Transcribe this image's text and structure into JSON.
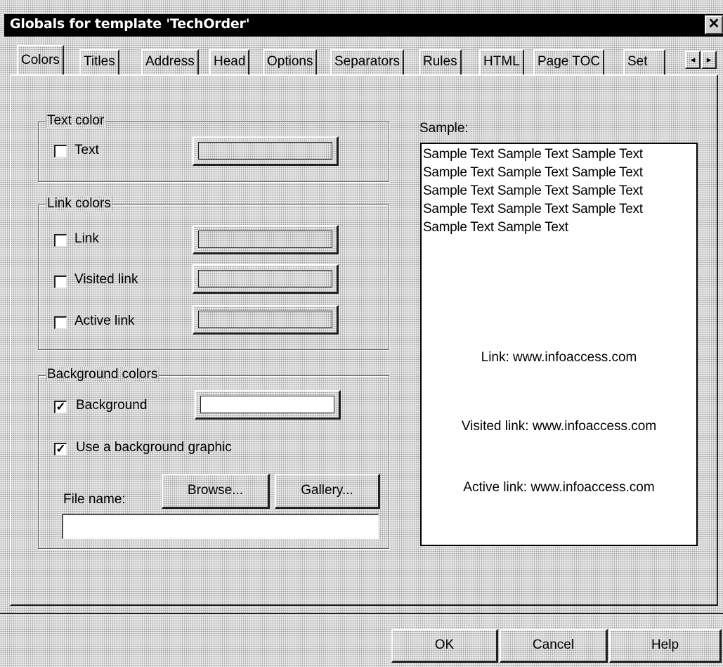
{
  "window": {
    "title": "Globals for template 'TechOrder'",
    "close_symbol": "✕"
  },
  "tabs": [
    {
      "label": "Colors",
      "active": true
    },
    {
      "label": "Titles"
    },
    {
      "label": "Address"
    },
    {
      "label": "Head"
    },
    {
      "label": "Options"
    },
    {
      "label": "Separators"
    },
    {
      "label": "Rules"
    },
    {
      "label": "HTML"
    },
    {
      "label": "Page TOC"
    },
    {
      "label": "Set"
    }
  ],
  "tab_scroll": {
    "left_icon": "◂",
    "right_icon": "▸"
  },
  "text_color_group": {
    "label": "Text color",
    "items": [
      {
        "label": "Text",
        "checked": false,
        "swatch": ""
      }
    ]
  },
  "link_colors_group": {
    "label": "Link colors",
    "items": [
      {
        "label": "Link",
        "checked": false,
        "swatch": ""
      },
      {
        "label": "Visited link",
        "checked": false,
        "swatch": ""
      },
      {
        "label": "Active link",
        "checked": false,
        "swatch": ""
      }
    ]
  },
  "background_group": {
    "label": "Background colors",
    "background": {
      "label": "Background",
      "checked": true,
      "swatch": "#ffffff"
    },
    "use_graphic": {
      "label": "Use a background graphic",
      "checked": true
    },
    "file_name_label": "File name:",
    "file_name_value": "",
    "browse_label": "Browse...",
    "gallery_label": "Gallery..."
  },
  "sample": {
    "label": "Sample:",
    "lines": [
      "Sample Text Sample Text Sample Text",
      "Sample Text Sample Text Sample Text",
      "Sample Text Sample Text Sample Text",
      "Sample Text Sample Text Sample Text",
      "Sample Text Sample Text"
    ],
    "link": "Link: www.infoaccess.com",
    "visited_link": "Visited link: www.infoaccess.com",
    "active_link": "Active link: www.infoaccess.com"
  },
  "footer": {
    "ok_label": "OK",
    "cancel_label": "Cancel",
    "help_label": "Help"
  },
  "colors": {
    "dialog_face": "#d8d8d8",
    "title_bar": "#000000",
    "title_text": "#ffffff"
  }
}
